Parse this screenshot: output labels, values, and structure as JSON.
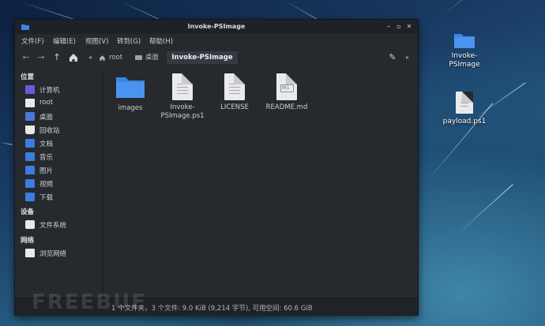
{
  "window": {
    "title": "Invoke-PSImage",
    "controls": [
      "minimize-icon",
      "maximize-icon",
      "close-icon"
    ]
  },
  "menu": [
    "文件(F)",
    "编辑(E)",
    "视图(V)",
    "转到(G)",
    "帮助(H)"
  ],
  "toolbar": {
    "icons": [
      "back-arrow-icon",
      "forward-arrow-icon",
      "up-arrow-icon",
      "home-icon",
      "pencil-icon"
    ],
    "breadcrumbs": [
      "root",
      "桌面",
      "Invoke-PSImage"
    ]
  },
  "sidebar": {
    "sections": [
      {
        "title": "位置",
        "items": [
          {
            "label": "计算机",
            "icon": "computer-icon",
            "color": "#6b5ad6"
          },
          {
            "label": "root",
            "icon": "home-folder-icon",
            "color": "#e8e8e8"
          },
          {
            "label": "桌面",
            "icon": "desktop-icon",
            "color": "#4a78d6"
          },
          {
            "label": "回收站",
            "icon": "trash-icon",
            "color": "#e8e8e8"
          },
          {
            "label": "文档",
            "icon": "documents-folder-icon",
            "color": "#3b7de0"
          },
          {
            "label": "音乐",
            "icon": "music-folder-icon",
            "color": "#3b7de0"
          },
          {
            "label": "图片",
            "icon": "pictures-folder-icon",
            "color": "#3b7de0"
          },
          {
            "label": "视频",
            "icon": "videos-folder-icon",
            "color": "#3b7de0"
          },
          {
            "label": "下载",
            "icon": "downloads-folder-icon",
            "color": "#3b7de0"
          }
        ]
      },
      {
        "title": "设备",
        "items": [
          {
            "label": "文件系统",
            "icon": "drive-icon",
            "color": "#e8e8e8"
          }
        ]
      },
      {
        "title": "网络",
        "items": [
          {
            "label": "浏览网络",
            "icon": "network-icon",
            "color": "#e8e8e8"
          }
        ]
      }
    ]
  },
  "files": [
    {
      "name": "images",
      "icon": "folder-icon"
    },
    {
      "name": "Invoke-\nPSImage.ps1",
      "icon": "text-file-icon"
    },
    {
      "name": "LICENSE",
      "icon": "text-file-icon"
    },
    {
      "name": "README.md",
      "icon": "markdown-file-icon"
    }
  ],
  "status": "1 个文件夹，3 个文件: 9.0 KiB (9,214 字节), 可用空间: 60.6 GiB",
  "desktop": [
    {
      "label": "Invoke-\nPSImage",
      "icon": "folder-icon"
    },
    {
      "label": "payload.ps1",
      "icon": "text-file-icon"
    }
  ],
  "watermark": "FREEBUF",
  "colors": {
    "folder": "#3d86e8",
    "window_bg": "#26292e",
    "titlebar_bg": "#1e2125"
  }
}
